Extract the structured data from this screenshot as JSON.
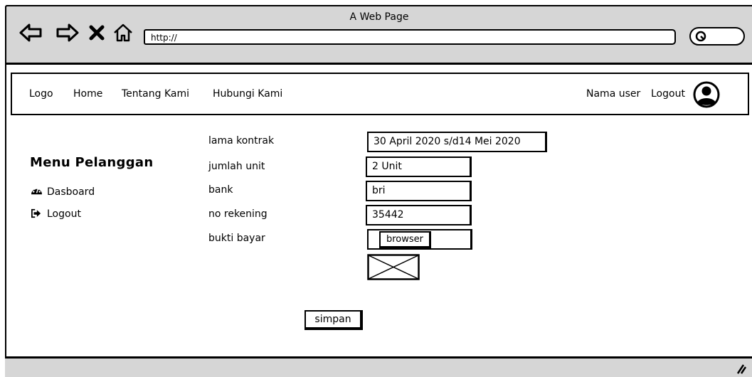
{
  "window": {
    "title": "A Web Page"
  },
  "browser": {
    "url": "http://",
    "icons": [
      "back-arrow-icon",
      "forward-arrow-icon",
      "close-icon",
      "home-icon",
      "search-icon"
    ]
  },
  "navbar": {
    "logo": "Logo",
    "home": "Home",
    "about": "Tentang Kami",
    "contact": "Hubungi Kami",
    "user_name": "Nama user",
    "logout": "Logout"
  },
  "sidebar": {
    "title": "Menu Pelanggan",
    "items": [
      {
        "label": "Dasboard",
        "icon": "dashboard-icon"
      },
      {
        "label": "Logout",
        "icon": "sign-out-icon"
      }
    ]
  },
  "form": {
    "fields": [
      {
        "label": "lama kontrak",
        "value": "30 April 2020 s/d14 Mei 2020"
      },
      {
        "label": "jumlah unit",
        "value": "2 Unit"
      },
      {
        "label": "bank",
        "value": "bri"
      },
      {
        "label": "no rekening",
        "value": "35442"
      },
      {
        "label": "bukti bayar",
        "value": ""
      }
    ],
    "browse_label": "browser",
    "submit_label": "simpan"
  }
}
